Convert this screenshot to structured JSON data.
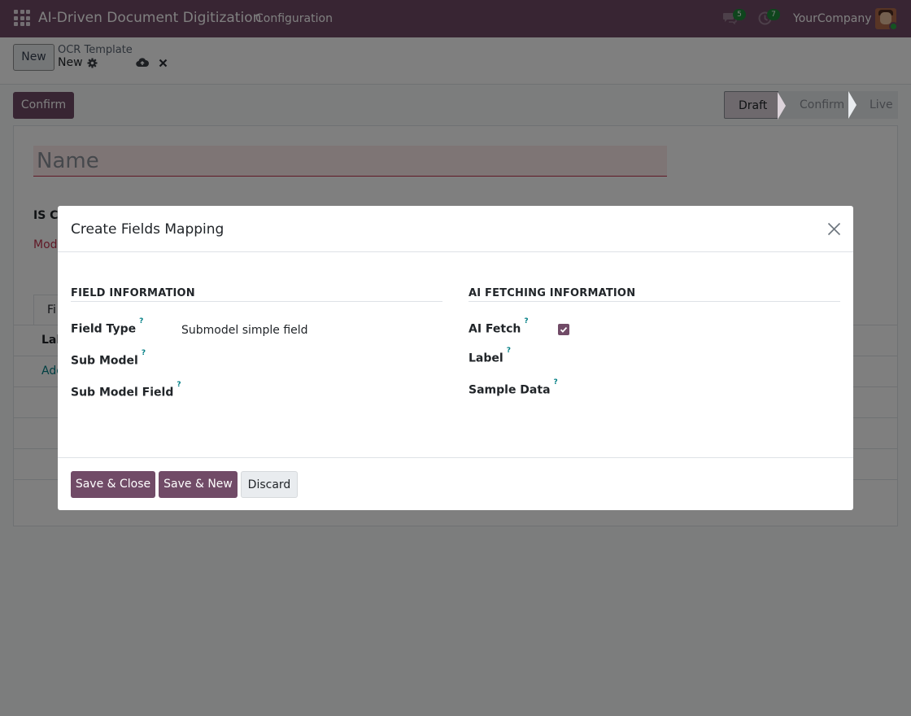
{
  "navbar": {
    "app_name": "AI-Driven Document Digitization",
    "menu": "Configuration",
    "chat_count": "5",
    "activity_count": "7",
    "company": "YourCompany",
    "color": "#714b67"
  },
  "control_panel": {
    "new_button": "New",
    "breadcrumb_parent": "OCR Template",
    "breadcrumb_current": "New"
  },
  "form": {
    "confirm_button": "Confirm",
    "status_stages": [
      "Draft",
      "Confirm",
      "Live"
    ],
    "active_stage": "Draft",
    "name_placeholder": "Name",
    "bg_label_1": "IS Ch",
    "bg_label_2": "Mod",
    "bg_tab": "Fi",
    "bg_table_header": "Lab",
    "bg_add_line": "Add"
  },
  "modal": {
    "title": "Create Fields Mapping",
    "left_section": {
      "title": "FIELD INFORMATION",
      "fields": [
        {
          "label": "Field Type",
          "help": "?",
          "value": "Submodel simple field"
        },
        {
          "label": "Sub Model",
          "help": "?",
          "value": ""
        },
        {
          "label": "Sub Model Field",
          "help": "?",
          "value": ""
        }
      ]
    },
    "right_section": {
      "title": "AI FETCHING INFORMATION",
      "fields": [
        {
          "label": "AI Fetch",
          "help": "?",
          "checked": true
        },
        {
          "label": "Label",
          "help": "?",
          "value": ""
        },
        {
          "label": "Sample Data",
          "help": "?",
          "value": ""
        }
      ]
    },
    "footer": {
      "save_close": "Save & Close",
      "save_new": "Save & New",
      "discard": "Discard"
    }
  }
}
